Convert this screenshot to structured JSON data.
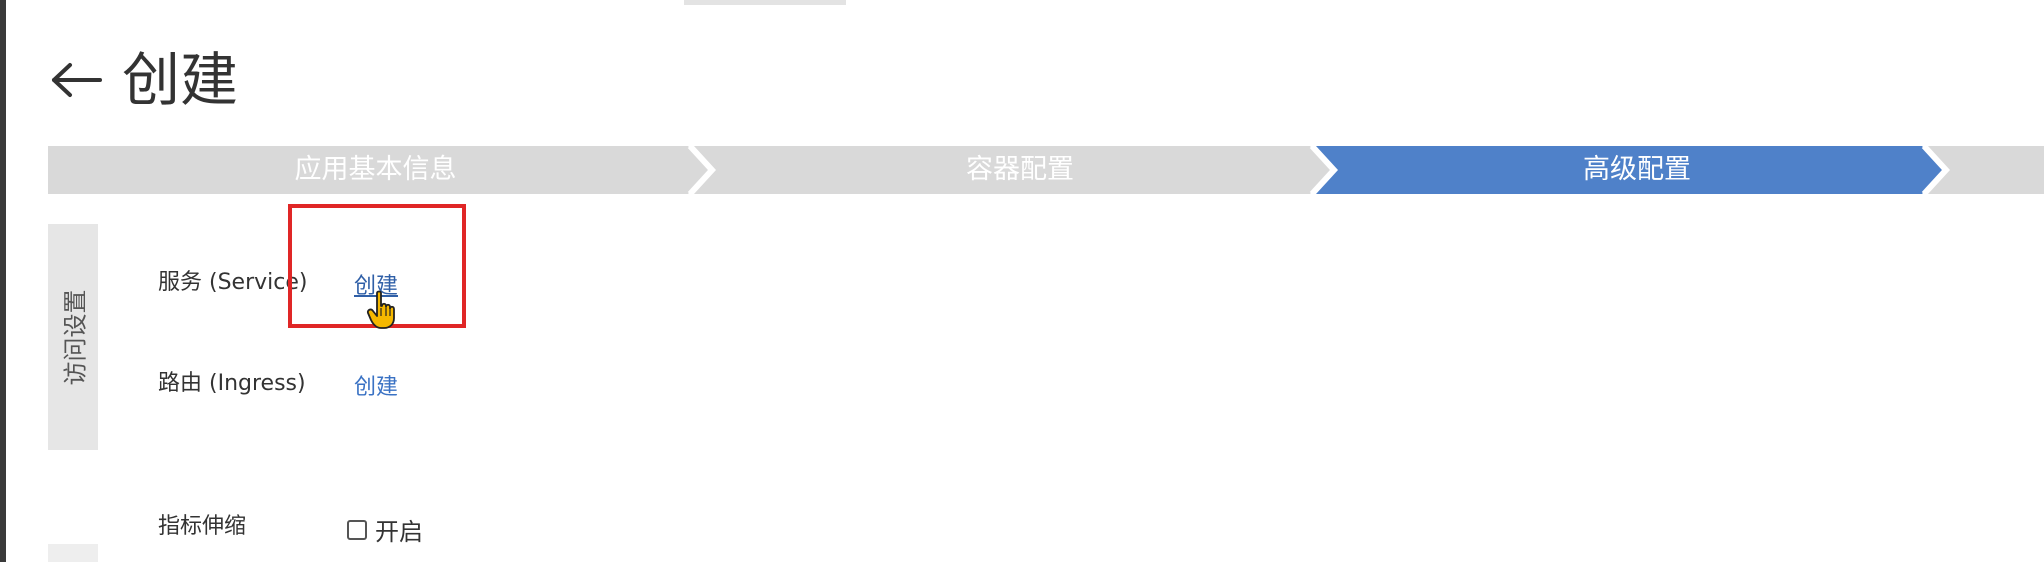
{
  "page": {
    "title": "创建"
  },
  "stepper": {
    "steps": [
      {
        "label": "应用基本信息",
        "state": "completed"
      },
      {
        "label": "容器配置",
        "state": "completed"
      },
      {
        "label": "高级配置",
        "state": "active"
      },
      {
        "label": "",
        "state": "pending"
      }
    ],
    "colors": {
      "inactive": "#d9d9d9",
      "active": "#4f81c9"
    }
  },
  "access_settings": {
    "section_label": "访问设置",
    "rows": [
      {
        "label": "服务 (Service)",
        "action_label": "创建"
      },
      {
        "label": "路由 (Ingress)",
        "action_label": "创建"
      }
    ]
  },
  "autoscaling": {
    "label": "指标伸缩",
    "checkbox_label": "开启",
    "checked": false
  },
  "annotation": {
    "highlight_color": "#e02626"
  },
  "icons": {
    "back": "arrow-left-icon",
    "cursor": "hand-pointer-cursor"
  }
}
